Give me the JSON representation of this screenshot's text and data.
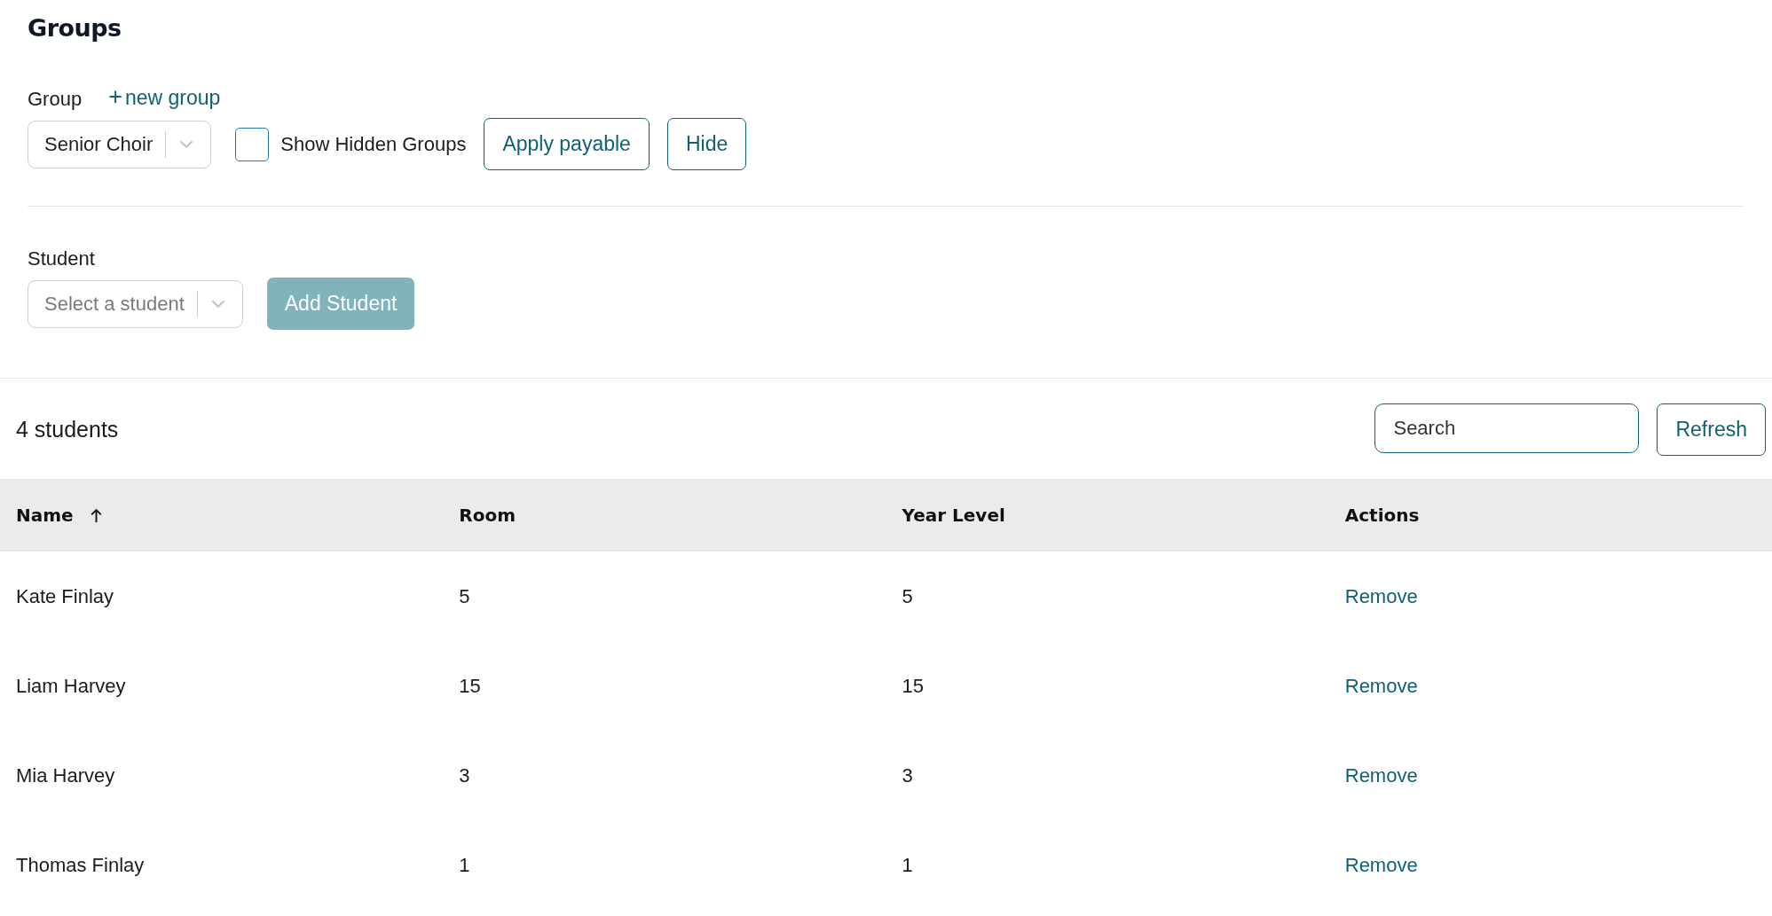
{
  "page": {
    "title": "Groups"
  },
  "group_section": {
    "label": "Group",
    "new_link": {
      "icon": "+",
      "label": "new group"
    },
    "select": {
      "value": "Senior Choir"
    },
    "show_hidden": {
      "label": "Show Hidden Groups",
      "checked": false
    },
    "buttons": [
      {
        "label": "Apply payable"
      },
      {
        "label": "Hide"
      }
    ]
  },
  "student_section": {
    "label": "Student",
    "select": {
      "placeholder": "Select a student"
    },
    "add_button": {
      "label": "Add Student",
      "disabled": true
    }
  },
  "list_header": {
    "count": "4 students",
    "search": {
      "placeholder": "Search"
    },
    "refresh": {
      "label": "Refresh"
    }
  },
  "table": {
    "columns": [
      {
        "label": "Name",
        "sorted": true
      },
      {
        "label": "Room",
        "sorted": false
      },
      {
        "label": "Year Level",
        "sorted": false
      },
      {
        "label": "Actions",
        "sorted": false
      }
    ],
    "rows": [
      {
        "name": "Kate Finlay",
        "room": "5",
        "year_level": "5",
        "action": "Remove"
      },
      {
        "name": "Liam Harvey",
        "room": "15",
        "year_level": "15",
        "action": "Remove"
      },
      {
        "name": "Mia Harvey",
        "room": "3",
        "year_level": "3",
        "action": "Remove"
      },
      {
        "name": "Thomas Finlay",
        "room": "1",
        "year_level": "1",
        "action": "Remove"
      }
    ]
  }
}
